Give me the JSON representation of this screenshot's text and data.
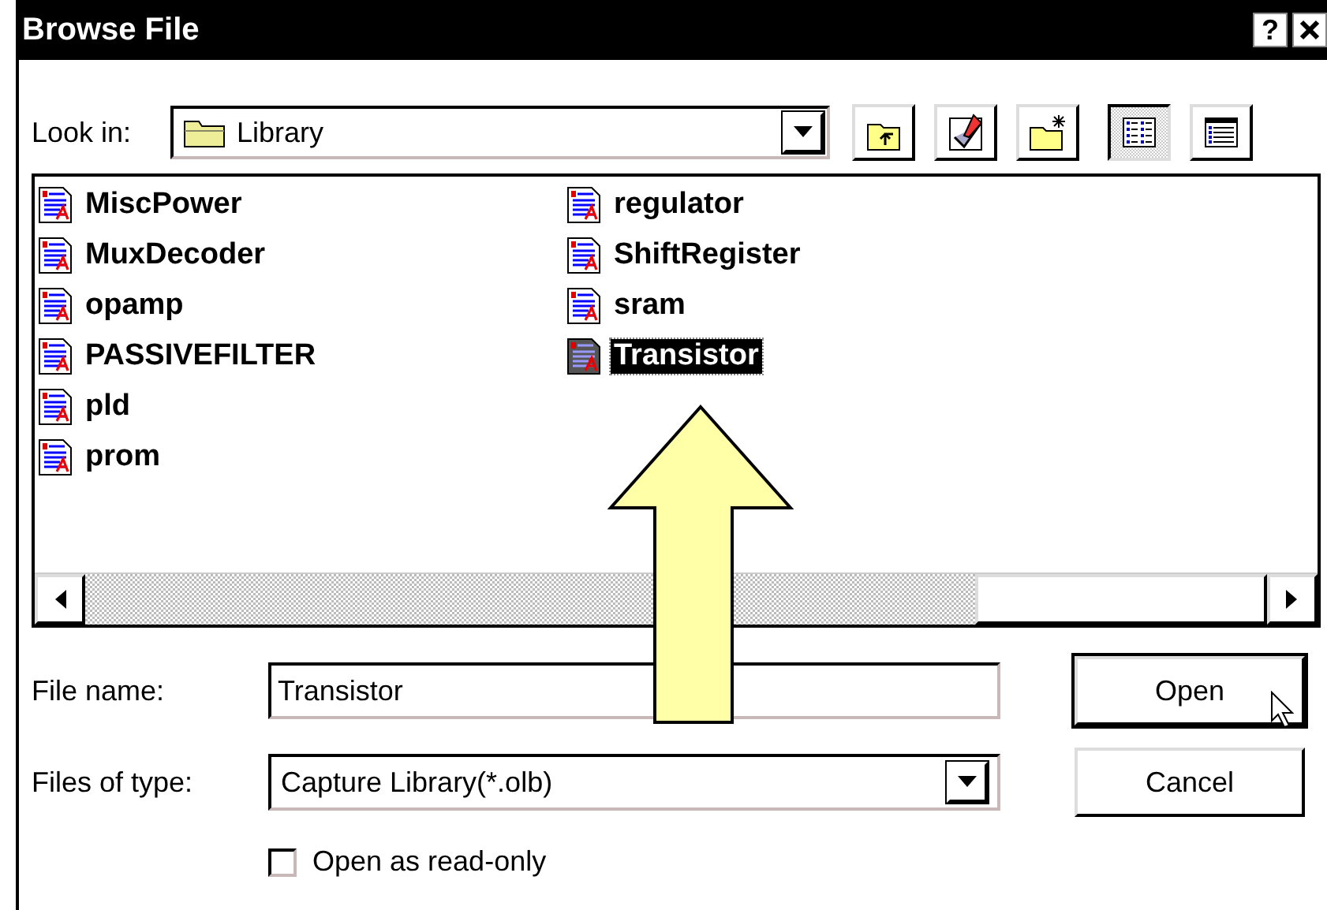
{
  "window": {
    "title": "Browse File",
    "help": "?"
  },
  "look_in": {
    "label": "Look in:",
    "value": "Library"
  },
  "toolbar": [
    {
      "kind": "up",
      "selected": false
    },
    {
      "kind": "desktop",
      "selected": false
    },
    {
      "kind": "newfolder",
      "selected": false
    },
    {
      "kind": "list",
      "selected": true
    },
    {
      "kind": "details",
      "selected": false
    }
  ],
  "files": [
    {
      "name": "MiscPower",
      "selected": false
    },
    {
      "name": "MuxDecoder",
      "selected": false
    },
    {
      "name": "opamp",
      "selected": false
    },
    {
      "name": "PASSIVEFILTER",
      "selected": false
    },
    {
      "name": "pld",
      "selected": false
    },
    {
      "name": "prom",
      "selected": false
    },
    {
      "name": "regulator",
      "selected": false
    },
    {
      "name": "ShiftRegister",
      "selected": false
    },
    {
      "name": "sram",
      "selected": false
    },
    {
      "name": "Transistor",
      "selected": true
    }
  ],
  "file_name": {
    "label": "File name:",
    "value": "Transistor"
  },
  "file_type": {
    "label": "Files of type:",
    "value": "Capture Library(*.olb)"
  },
  "read_only": {
    "label": "Open as read-only",
    "checked": false
  },
  "buttons": [
    {
      "label": "Open",
      "default": true
    },
    {
      "label": "Cancel",
      "default": false
    }
  ]
}
